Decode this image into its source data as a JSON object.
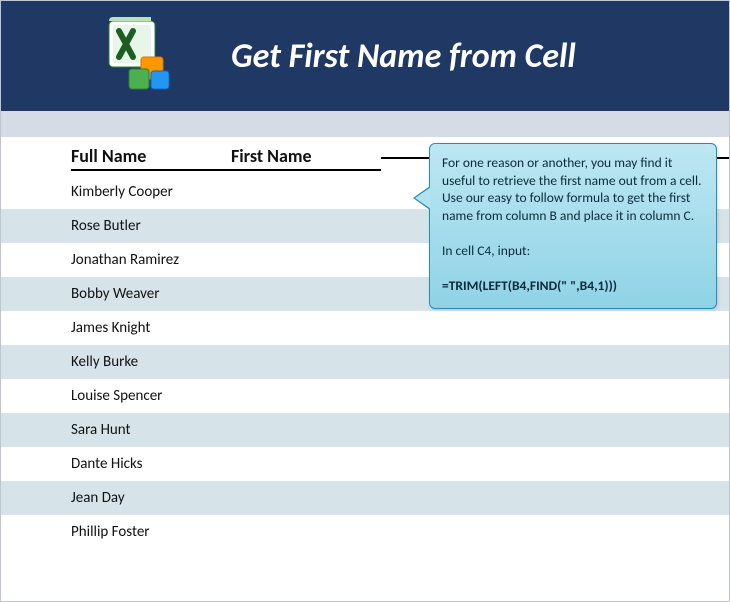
{
  "header": {
    "title": "Get First Name from Cell",
    "icon": "excel-icon"
  },
  "columns": {
    "full_name": "Full Name",
    "first_name": "First Name"
  },
  "rows": [
    {
      "full": "Kimberly Cooper",
      "first": ""
    },
    {
      "full": "Rose Butler",
      "first": ""
    },
    {
      "full": "Jonathan Ramirez",
      "first": ""
    },
    {
      "full": "Bobby Weaver",
      "first": ""
    },
    {
      "full": "James Knight",
      "first": ""
    },
    {
      "full": "Kelly Burke",
      "first": ""
    },
    {
      "full": "Louise Spencer",
      "first": ""
    },
    {
      "full": "Sara Hunt",
      "first": ""
    },
    {
      "full": "Dante Hicks",
      "first": ""
    },
    {
      "full": "Jean Day",
      "first": ""
    },
    {
      "full": "Phillip Foster",
      "first": ""
    }
  ],
  "callout": {
    "p1": "For one reason or another, you may find it useful to retrieve the first name out from a cell. Use our easy to follow formula to get the first name from column B and place it in column C.",
    "p2": "In cell C4, input:",
    "formula": "=TRIM(LEFT(B4,FIND(\" \",B4,1)))"
  }
}
